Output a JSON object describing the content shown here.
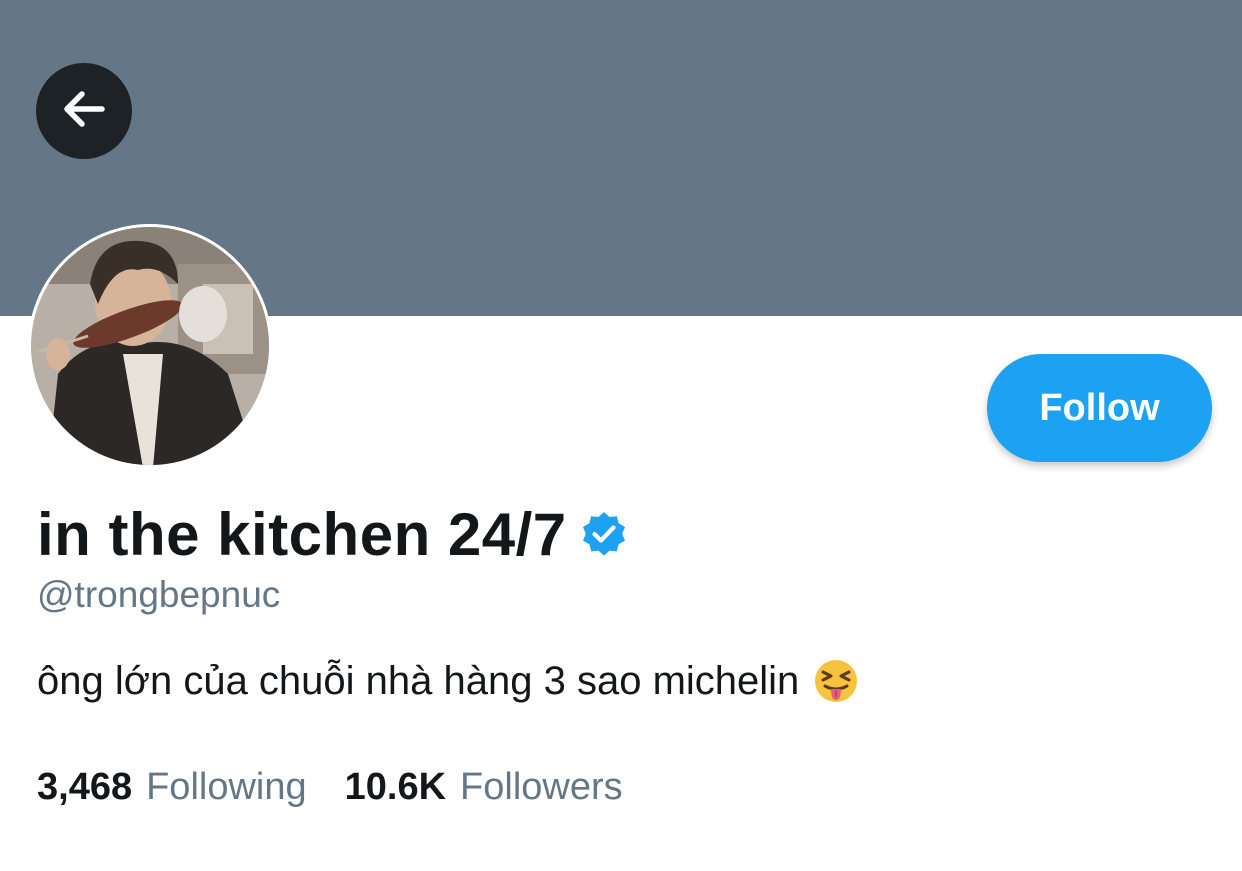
{
  "profile": {
    "display_name": "in the kitchen 24/7",
    "handle": "@trongbepnuc",
    "bio": "ông lớn của chuỗi nhà hàng 3 sao michelin",
    "bio_emoji": "squinting-face-with-tongue",
    "verified": true
  },
  "actions": {
    "follow_label": "Follow",
    "back_icon": "arrow-left-icon"
  },
  "stats": {
    "following_count": "3,468",
    "following_label": "Following",
    "followers_count": "10.6K",
    "followers_label": "Followers"
  },
  "colors": {
    "banner": "#657786",
    "accent": "#1da1f2",
    "text_primary": "#14171a",
    "text_secondary": "#657786"
  }
}
